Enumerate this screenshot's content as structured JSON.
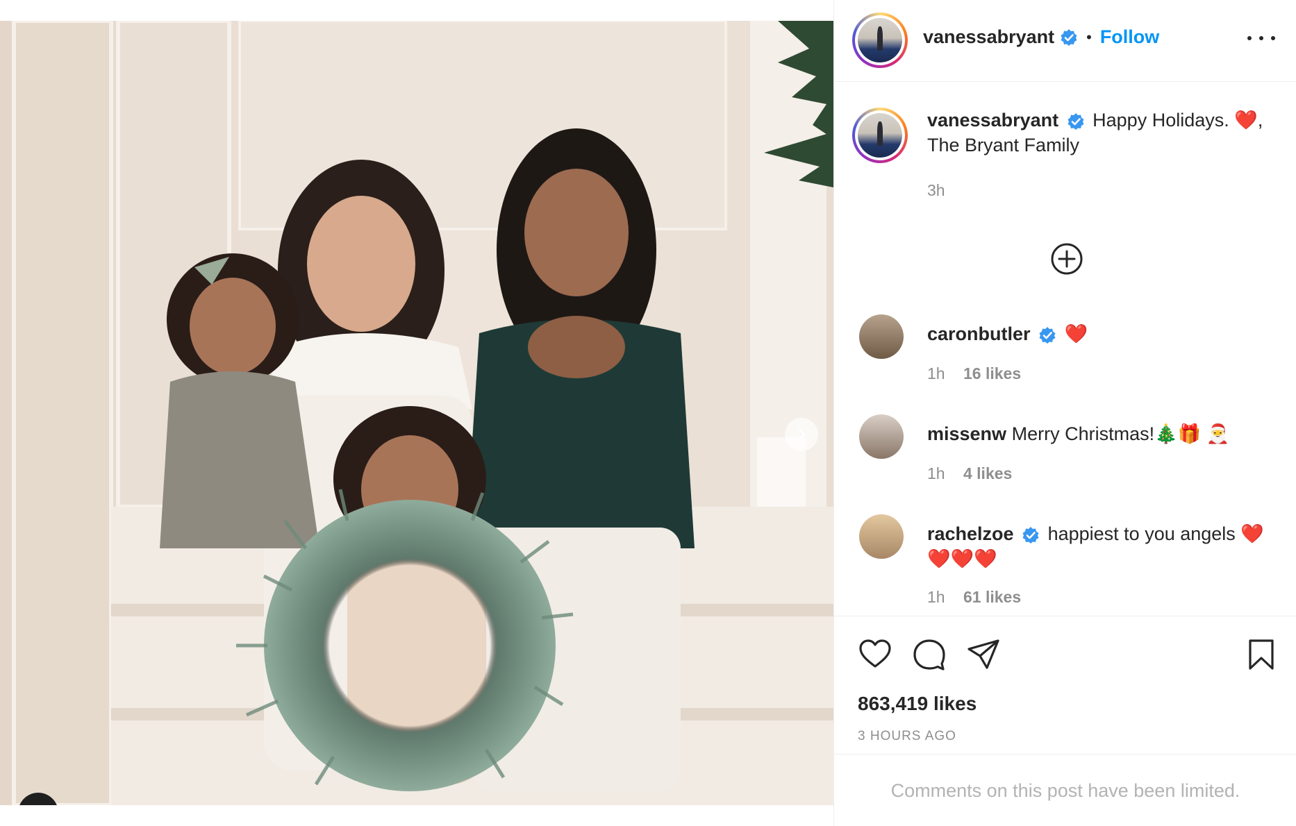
{
  "post": {
    "author": "vanessabryant",
    "verified": true,
    "follow_label": "Follow",
    "follow_separator": "•",
    "caption_text": "Happy Holidays. ❤️,",
    "caption_line2": "The Bryant Family",
    "caption_time": "3h",
    "likes": "863,419 likes",
    "time_ago": "3 HOURS AGO",
    "comments_limited": "Comments on this post have been limited."
  },
  "comments": [
    {
      "user": "caronbutler",
      "verified": true,
      "text": "❤️",
      "time": "1h",
      "likes": "16 likes"
    },
    {
      "user": "missenw",
      "verified": false,
      "text": "Merry Christmas!🎄🎁 🎅",
      "time": "1h",
      "likes": "4 likes"
    },
    {
      "user": "rachelzoe",
      "verified": true,
      "text": "happiest to you angels ❤️",
      "text_line2": "❤️❤️❤️",
      "time": "1h",
      "likes": "61 likes"
    }
  ],
  "icons": {
    "verified": "verified-badge-icon",
    "more": "more-options-icon",
    "add": "add-circle-icon",
    "like": "heart-outline-icon",
    "comment": "comment-bubble-icon",
    "share": "paper-plane-icon",
    "save": "bookmark-icon",
    "next": "chevron-right-icon",
    "tag": "user-tag-icon"
  },
  "colors": {
    "accent": "#0095f6",
    "verified": "#3897f0",
    "heart": "#ed1c24",
    "muted": "#8e8e8e"
  }
}
